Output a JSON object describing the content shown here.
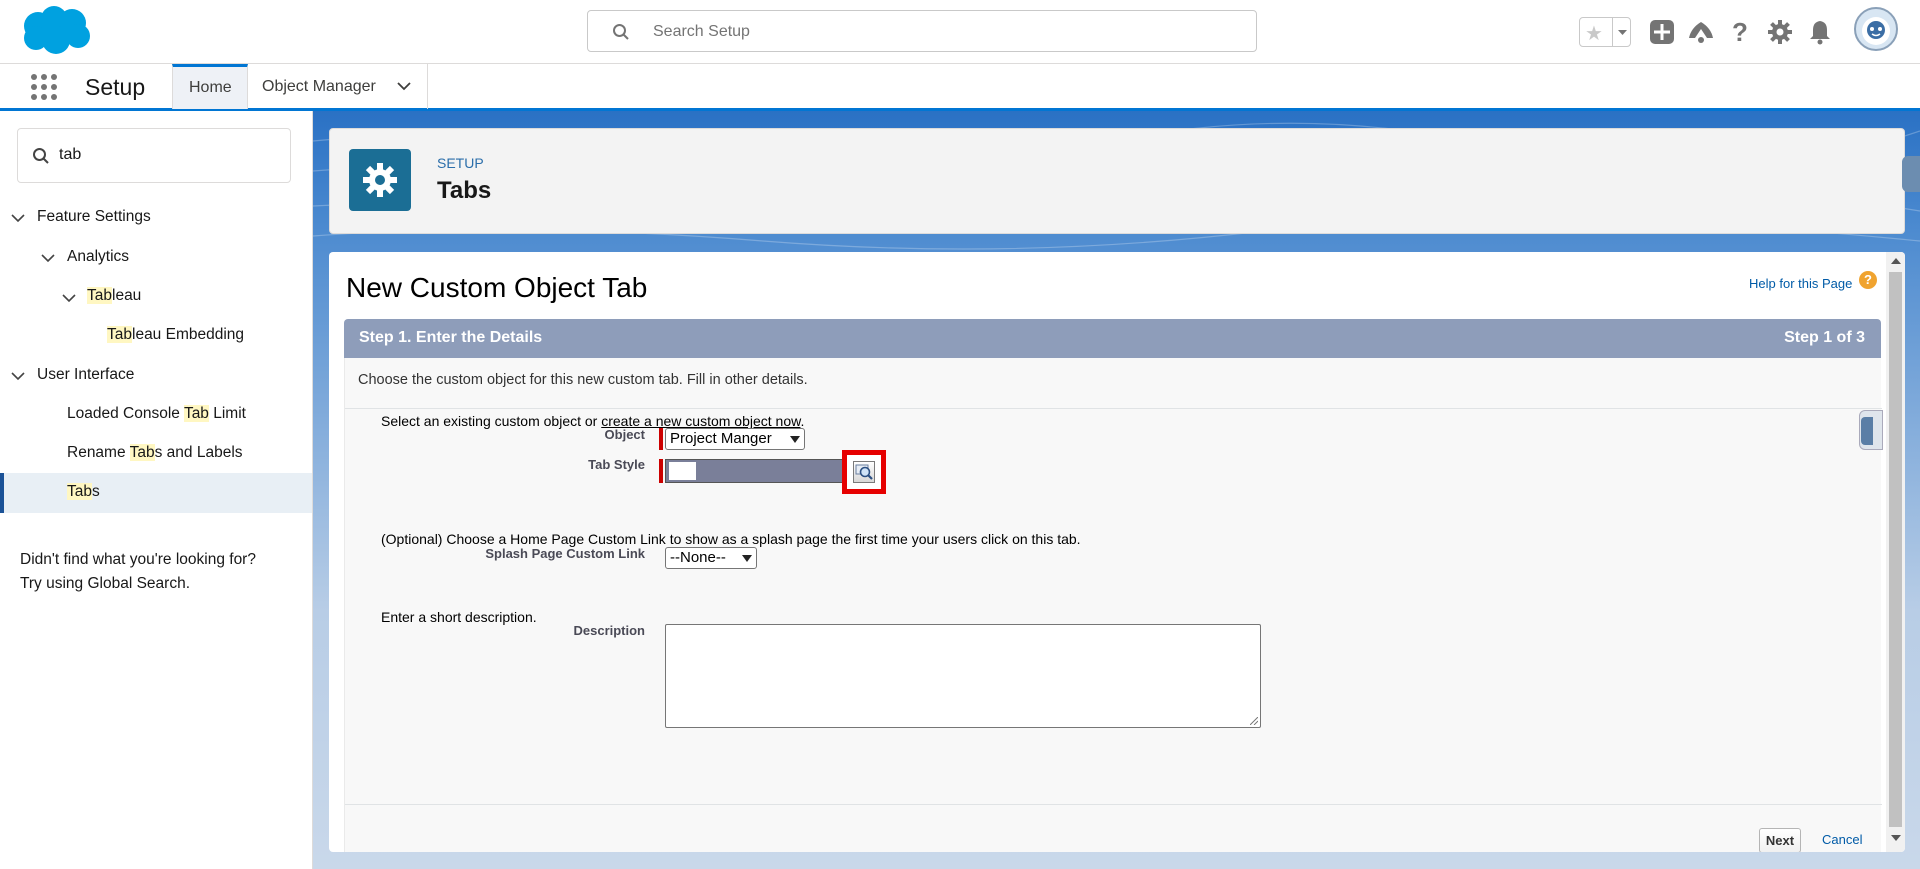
{
  "header": {
    "search_placeholder": "Search Setup",
    "icons": [
      "salesforce-logo",
      "favorites-star-icon",
      "add-icon",
      "trailhead-icon",
      "help-icon",
      "gear-icon",
      "bell-icon",
      "avatar"
    ]
  },
  "context_nav": {
    "app_name": "Setup",
    "tabs": [
      {
        "label": "Home",
        "active": true
      },
      {
        "label": "Object Manager",
        "active": false
      }
    ]
  },
  "sidebar": {
    "search_value": "tab",
    "tree": [
      {
        "label": "Feature Settings",
        "expanded": true
      },
      {
        "label": "Analytics",
        "expanded": true
      },
      {
        "pre": "",
        "hl": "Tab",
        "post": "leau",
        "expanded": true
      },
      {
        "pre": "",
        "hl": "Tab",
        "post": "leau Embedding"
      },
      {
        "label": "User Interface",
        "expanded": true
      },
      {
        "pre": "Loaded Console ",
        "hl": "Tab",
        "post": " Limit"
      },
      {
        "pre": "Rename ",
        "hl": "Tab",
        "post": "s and Labels"
      },
      {
        "pre": "",
        "hl": "Tab",
        "post": "s",
        "selected": true
      }
    ],
    "help_line1": "Didn't find what you're looking for?",
    "help_line2": "Try using Global Search."
  },
  "page_header": {
    "eyebrow": "SETUP",
    "title": "Tabs"
  },
  "content": {
    "title": "New Custom Object Tab",
    "help_link": "Help for this Page",
    "step_title": "Step 1. Enter the Details",
    "step_count": "Step 1 of 3",
    "instructions": "Choose the custom object for this new custom tab. Fill in other details.",
    "select_object_prefix": "Select an existing custom object or ",
    "select_object_link": "create a new custom object now",
    "select_object_suffix": ".",
    "object_label": "Object",
    "object_value": "Project Manger",
    "tab_style_label": "Tab Style",
    "splash_instructions": "(Optional) Choose a Home Page Custom Link to show as a splash page the first time your users click on this tab.",
    "splash_label": "Splash Page Custom Link",
    "splash_value": "--None--",
    "description_instructions": "Enter a short description.",
    "description_label": "Description",
    "description_value": "",
    "next_button": "Next",
    "cancel_link": "Cancel"
  },
  "colors": {
    "brand": "#0176d3",
    "step_bar": "#8e9dba",
    "highlight_box": "#e60000",
    "search_highlight": "#fff7c2"
  }
}
